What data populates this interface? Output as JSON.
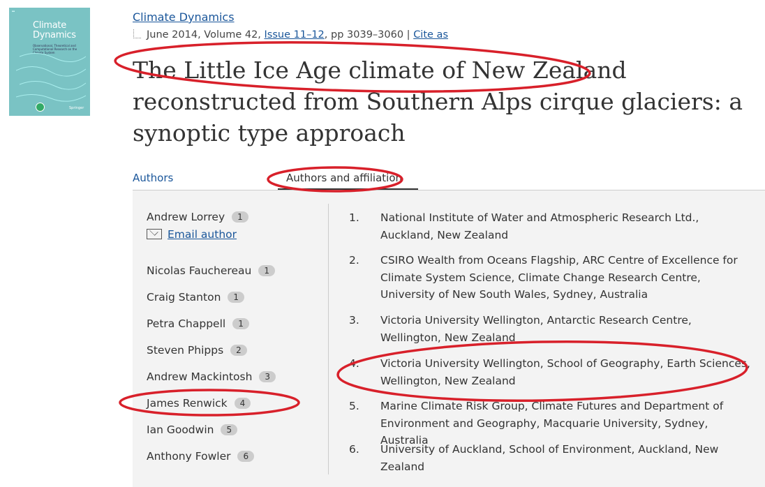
{
  "cover": {
    "title_line1": "Climate",
    "title_line2": "Dynamics",
    "publisher": "Springer",
    "subtitle": "Observational, Theoretical and Computational Research on the Climate System"
  },
  "journal": "Climate Dynamics",
  "meta": {
    "date_volume": "June 2014, Volume 42, ",
    "issue": "Issue 11–12",
    "pages": ", pp 3039–3060 | ",
    "cite": "Cite as"
  },
  "title": "The Little Ice Age climate of New Zealand reconstructed from Southern Alps cirque glaciers: a synoptic type approach",
  "tabs": {
    "authors": "Authors",
    "affiliations": "Authors and affiliation"
  },
  "email_label": "Email author",
  "authors": [
    {
      "name": "Andrew Lorrey",
      "aff": "1"
    },
    {
      "name": "Nicolas Fauchereau",
      "aff": "1"
    },
    {
      "name": "Craig Stanton",
      "aff": "1"
    },
    {
      "name": "Petra Chappell",
      "aff": "1"
    },
    {
      "name": "Steven Phipps",
      "aff": "2"
    },
    {
      "name": "Andrew Mackintosh",
      "aff": "3"
    },
    {
      "name": "James Renwick",
      "aff": "4"
    },
    {
      "name": "Ian Goodwin",
      "aff": "5"
    },
    {
      "name": "Anthony Fowler",
      "aff": "6"
    }
  ],
  "affiliations": [
    {
      "num": "1.",
      "text": "National Institute of Water and Atmospheric Research Ltd., Auckland, New Zealand"
    },
    {
      "num": "2.",
      "text": "CSIRO Wealth from Oceans Flagship, ARC Centre of Excellence for Climate System Science, Climate Change Research Centre, University of New South Wales, Sydney, Australia"
    },
    {
      "num": "3.",
      "text": "Victoria University Wellington, Antarctic Research Centre, Wellington, New Zealand"
    },
    {
      "num": "4.",
      "text": "Victoria University Wellington, School of Geography, Earth Sciences, Wellington, New Zealand"
    },
    {
      "num": "5.",
      "text": "Marine Climate Risk Group, Climate Futures and Department of Environment and Geography, Macquarie University, Sydney, Australia"
    },
    {
      "num": "6.",
      "text": "University of Auckland, School of Environment, Auckland, New Zealand"
    }
  ],
  "colors": {
    "link": "#1a569a",
    "annotation": "#d8202a",
    "panel": "#f3f3f3"
  }
}
